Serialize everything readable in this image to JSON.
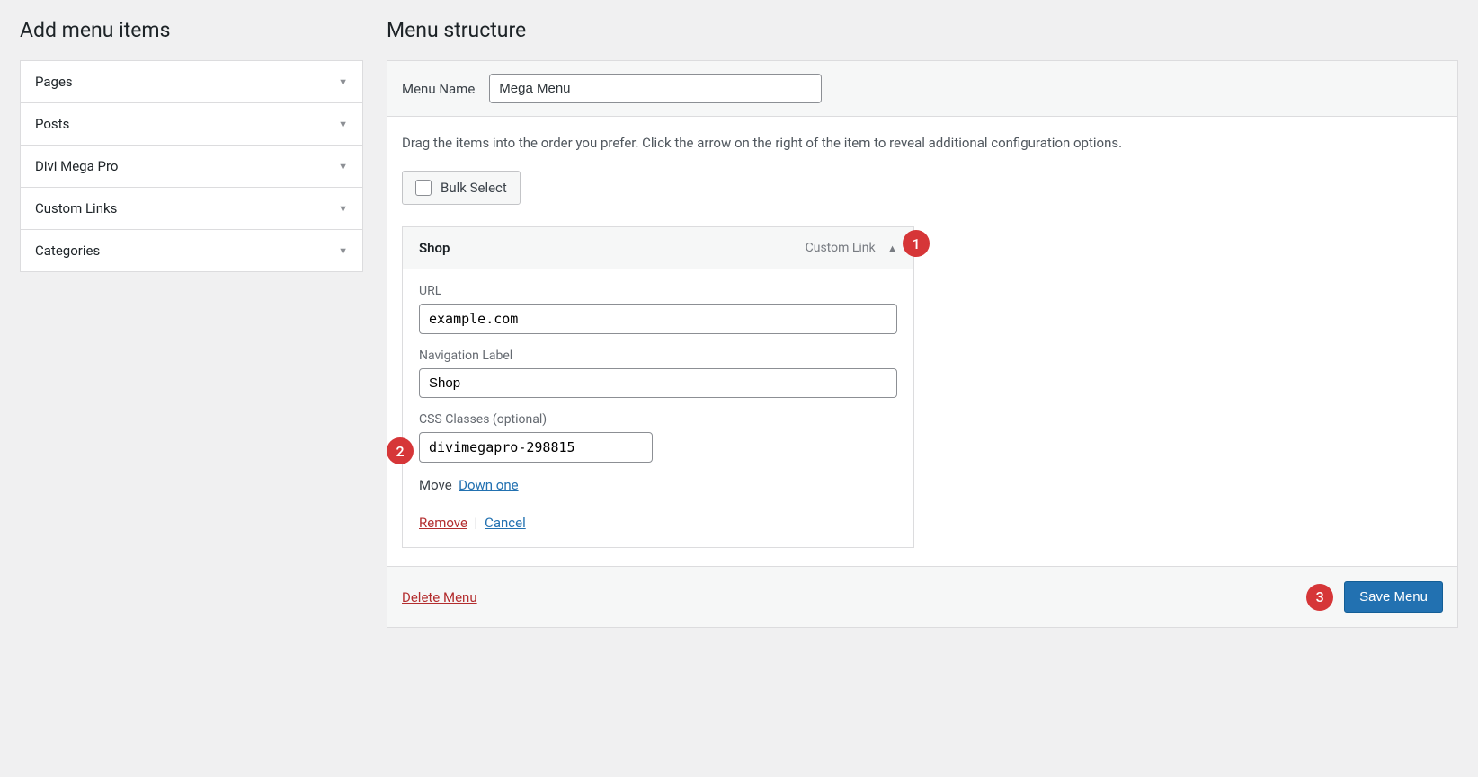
{
  "sidebar": {
    "title": "Add menu items",
    "items": [
      {
        "label": "Pages"
      },
      {
        "label": "Posts"
      },
      {
        "label": "Divi Mega Pro"
      },
      {
        "label": "Custom Links"
      },
      {
        "label": "Categories"
      }
    ]
  },
  "main": {
    "title": "Menu structure",
    "menu_name_label": "Menu Name",
    "menu_name_value": "Mega Menu",
    "instructions": "Drag the items into the order you prefer. Click the arrow on the right of the item to reveal additional configuration options.",
    "bulk_select_label": "Bulk Select",
    "item": {
      "title": "Shop",
      "type": "Custom Link",
      "url_label": "URL",
      "url_value": "example.com",
      "nav_label_label": "Navigation Label",
      "nav_label_value": "Shop",
      "css_classes_label": "CSS Classes (optional)",
      "css_classes_value": "divimegapro-298815",
      "move_label": "Move",
      "down_one": "Down one",
      "remove": "Remove",
      "cancel": "Cancel"
    },
    "delete_menu": "Delete Menu",
    "save_menu": "Save Menu"
  },
  "annotations": {
    "one": "1",
    "two": "2",
    "three": "3"
  }
}
